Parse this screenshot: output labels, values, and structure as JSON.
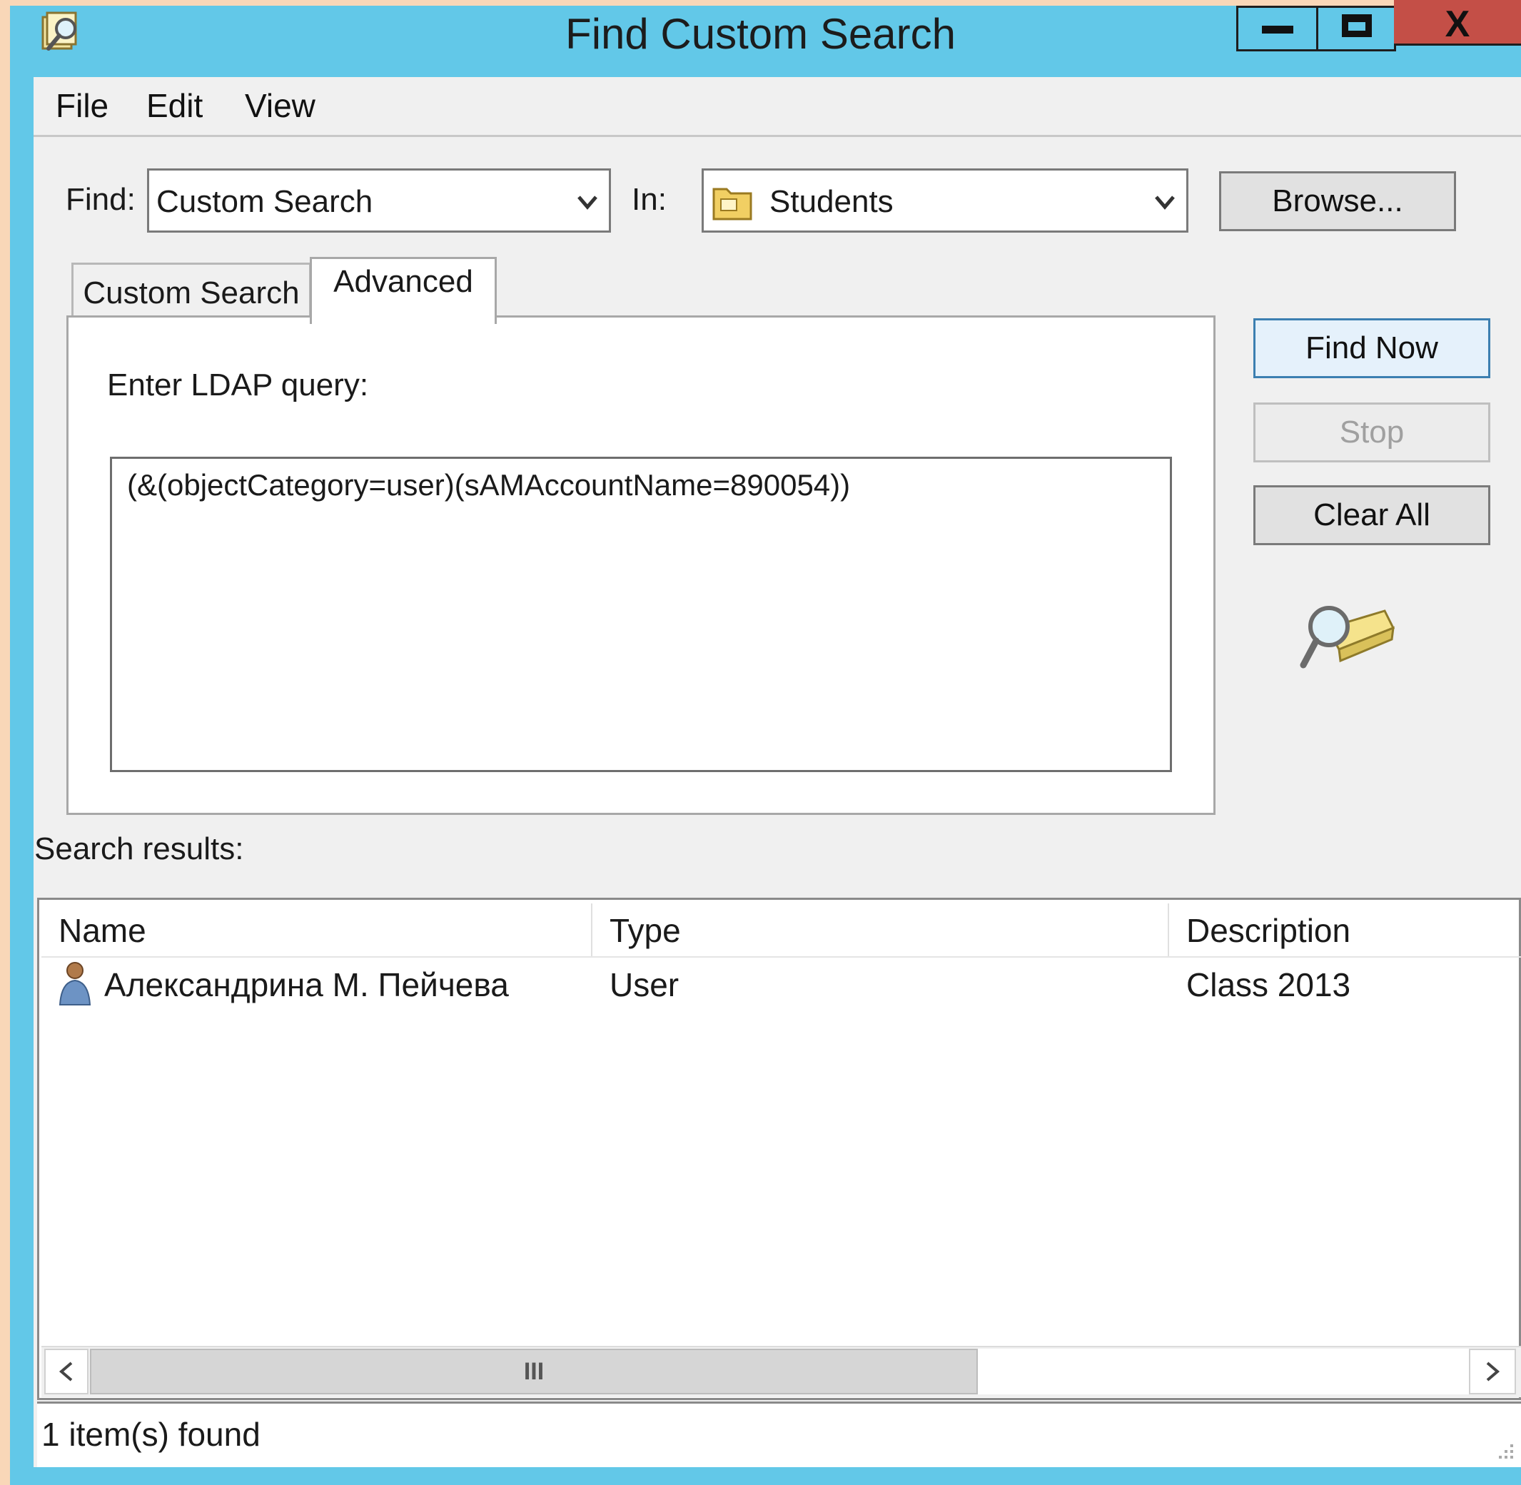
{
  "window": {
    "title": "Find Custom Search",
    "close_glyph": "X"
  },
  "menu": [
    "File",
    "Edit",
    "View"
  ],
  "find_row": {
    "find_label": "Find:",
    "find_value": "Custom Search",
    "in_label": "In:",
    "in_value": "Students",
    "browse_label": "Browse..."
  },
  "tabs": [
    {
      "label": "Custom Search",
      "selected": false
    },
    {
      "label": "Advanced",
      "selected": true
    }
  ],
  "advanced": {
    "prompt": "Enter LDAP query:",
    "query": "(&(objectCategory=user)(sAMAccountName=890054))"
  },
  "actions": {
    "find_now": "Find Now",
    "stop": "Stop",
    "clear_all": "Clear All"
  },
  "results": {
    "label": "Search results:",
    "columns": [
      "Name",
      "Type",
      "Description"
    ],
    "rows": [
      {
        "name": "Александрина М. Пейчева",
        "type": "User",
        "description": "Class 2013"
      }
    ],
    "scrollbar_glyph": "III"
  },
  "status": "1 item(s) found",
  "icons": {
    "title": "find-folder-icon",
    "in_combo": "ou-folder-icon",
    "animation": "search-flashlight-icon",
    "row_user": "user-icon"
  }
}
